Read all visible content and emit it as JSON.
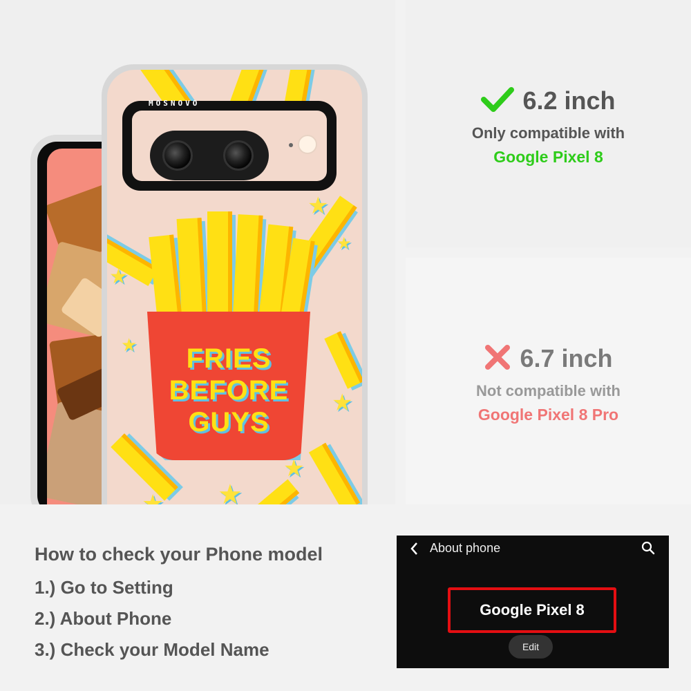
{
  "phone": {
    "brand_text": "MOSNOVO",
    "case_print": {
      "line1": "FRIES",
      "line2": "BEFORE",
      "line3": "GUYS"
    }
  },
  "compatible": {
    "icon": "check-icon",
    "size": "6.2 inch",
    "note": "Only compatible with",
    "model": "Google Pixel 8",
    "color": "#2ecc1a"
  },
  "incompatible": {
    "icon": "cross-icon",
    "size": "6.7 inch",
    "note": "Not compatible with",
    "model": "Google Pixel 8 Pro",
    "color": "#f07575"
  },
  "howto": {
    "title": "How to check your Phone model",
    "steps": [
      "1.) Go to Setting",
      "2.) About Phone",
      "3.) Check your Model Name"
    ]
  },
  "settings_screen": {
    "back_icon": "chevron-left-icon",
    "title": "About phone",
    "search_icon": "search-icon",
    "model_name": "Google Pixel 8",
    "edit_label": "Edit",
    "highlight_color": "#e40e12"
  }
}
